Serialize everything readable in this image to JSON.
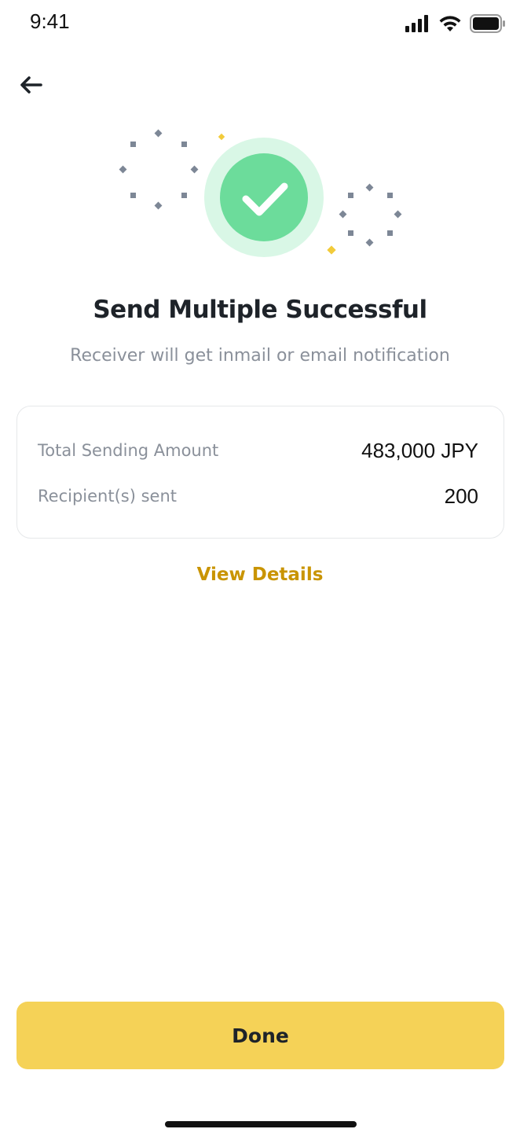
{
  "status_bar": {
    "time": "9:41"
  },
  "header": {
    "back_icon": "arrow-left-icon"
  },
  "illustration": {
    "icon": "check-icon",
    "colors": {
      "check_circle": "#6cdc9b",
      "check_halo": "#d9f7e6",
      "sparkle_gray": "#7d8796",
      "sparkle_yellow": "#f2cb3b"
    }
  },
  "main": {
    "title": "Send Multiple Successful",
    "subtitle": "Receiver will get inmail or email notification"
  },
  "summary": {
    "rows": [
      {
        "label": "Total Sending Amount",
        "value": "483,000 JPY"
      },
      {
        "label": "Recipient(s) sent",
        "value": "200"
      }
    ]
  },
  "links": {
    "view_details": "View Details"
  },
  "footer": {
    "done_label": "Done"
  },
  "colors": {
    "accent": "#f5d257",
    "link": "#c99400",
    "text_primary": "#1e2329",
    "text_secondary": "#8a909a"
  }
}
